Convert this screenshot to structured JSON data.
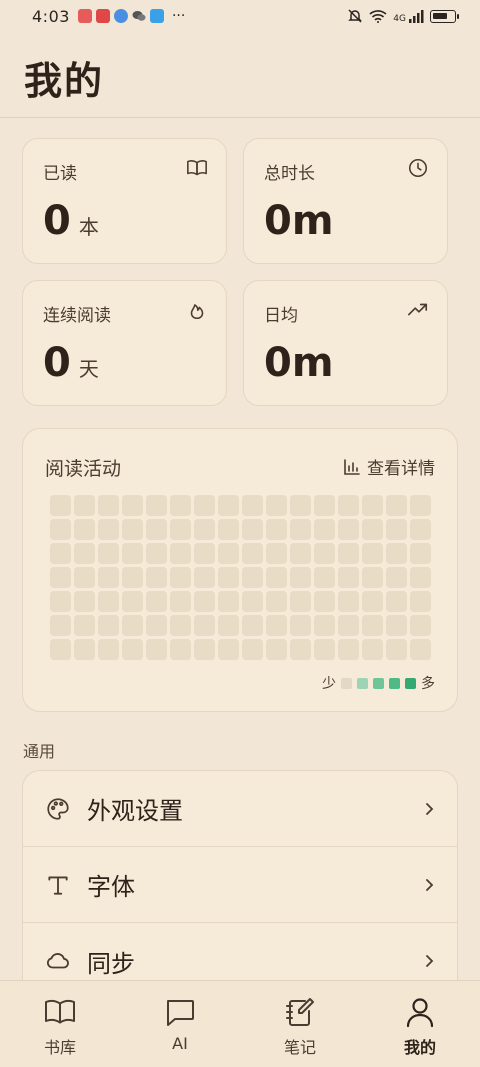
{
  "status_bar": {
    "time": "4:03",
    "more": "···",
    "network": "4G",
    "app_colors": [
      "#e85b5b",
      "#e04848",
      "#4a90e2",
      "#555555",
      "#3aa0e8"
    ]
  },
  "page": {
    "title": "我的"
  },
  "stats": [
    {
      "label": "已读",
      "value": "0",
      "unit": "本",
      "icon": "book-icon"
    },
    {
      "label": "总时长",
      "value": "0m",
      "unit": "",
      "icon": "clock-icon"
    },
    {
      "label": "连续阅读",
      "value": "0",
      "unit": "天",
      "icon": "flame-icon"
    },
    {
      "label": "日均",
      "value": "0m",
      "unit": "",
      "icon": "trending-up-icon"
    }
  ],
  "activity": {
    "title": "阅读活动",
    "detail_label": "查看详情",
    "legend_less": "少",
    "legend_more": "多",
    "legend_colors": [
      "#e3d8c4",
      "#9fd3b6",
      "#6fc59a",
      "#4fb987",
      "#35a873"
    ],
    "rows": 7,
    "cols": 16
  },
  "general": {
    "section_label": "通用",
    "items": [
      {
        "label": "外观设置",
        "icon": "palette-icon"
      },
      {
        "label": "字体",
        "icon": "type-icon"
      },
      {
        "label": "同步",
        "icon": "cloud-icon"
      }
    ]
  },
  "nav": {
    "items": [
      {
        "label": "书库",
        "icon": "library-icon"
      },
      {
        "label": "AI",
        "icon": "chat-icon"
      },
      {
        "label": "笔记",
        "icon": "notebook-icon"
      },
      {
        "label": "我的",
        "icon": "profile-icon",
        "active": true
      }
    ]
  }
}
